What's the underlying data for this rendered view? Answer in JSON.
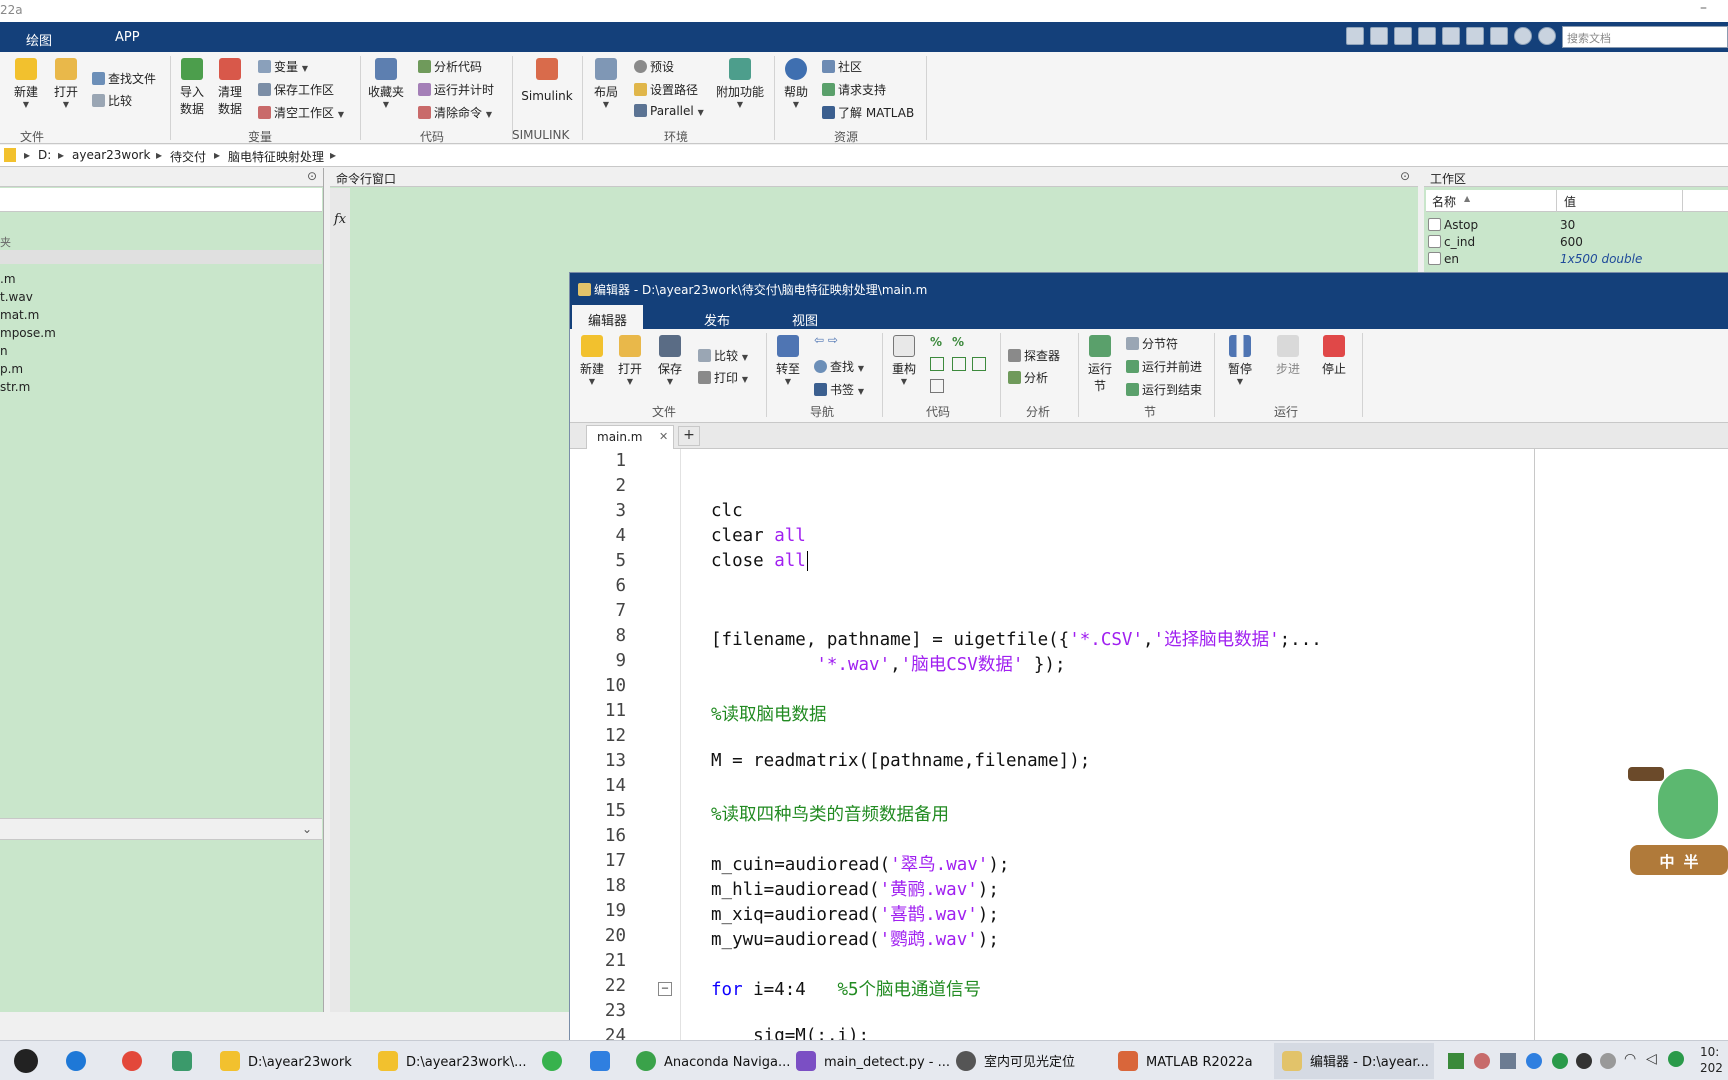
{
  "window": {
    "title": "22a",
    "min_glyph": "–"
  },
  "menubar": {
    "tabs": [
      "绘图",
      "APP"
    ],
    "search_placeholder": "搜索文档"
  },
  "ribbon": {
    "new": "新建",
    "open": "打开",
    "find_files": "查找文件",
    "compare": "比较",
    "group_file": "文件",
    "import_data_1": "导入",
    "import_data_2": "数据",
    "clean_data_1": "清理",
    "clean_data_2": "数据",
    "variable": "变量",
    "save_ws": "保存工作区",
    "clear_ws": "清空工作区",
    "group_variable": "变量",
    "favorites": "收藏夹",
    "analyze_code": "分析代码",
    "run_time": "运行并计时",
    "clear_cmds": "清除命令",
    "group_code": "代码",
    "simulink": "Simulink",
    "group_simulink": "SIMULINK",
    "layout": "布局",
    "preferences": "预设",
    "set_path": "设置路径",
    "parallel": "Parallel",
    "addons": "附加功能",
    "group_env": "环境",
    "help": "帮助",
    "community": "社区",
    "request_support": "请求支持",
    "learn_matlab": "了解 MATLAB",
    "group_resources": "资源"
  },
  "address": {
    "crumbs": [
      "D:",
      "ayear23work",
      "待交付",
      "脑电特征映射处理"
    ]
  },
  "leftpanel": {
    "section_label": "夹",
    "files": [
      ".m",
      "t.wav",
      "mat.m",
      "mpose.m",
      "n",
      "p.m",
      "str.m"
    ]
  },
  "cmdpanel": {
    "title": "命令行窗口",
    "fx": "fx"
  },
  "workspace": {
    "title": "工作区",
    "col_name": "名称",
    "col_value": "值",
    "vars": [
      {
        "name": "Astop",
        "value": "30"
      },
      {
        "name": "c_ind",
        "value": "600"
      },
      {
        "name": "en",
        "value": "1x500 double"
      }
    ]
  },
  "editor": {
    "title": "编辑器 - D:\\ayear23work\\待交付\\脑电特征映射处理\\main.m",
    "tabs": [
      "编辑器",
      "发布",
      "视图"
    ],
    "ribbon": {
      "new": "新建",
      "open": "打开",
      "save": "保存",
      "compare": "比较",
      "print": "打印",
      "group_file": "文件",
      "goto": "转至",
      "find": "查找",
      "bookmark": "书签",
      "group_nav": "导航",
      "refactor": "重构",
      "group_code": "代码",
      "profiler": "探查器",
      "analyze": "分析",
      "group_analyze": "分析",
      "run_section_1": "运行",
      "run_section_2": "节",
      "section_break": "分节符",
      "run_advance": "运行并前进",
      "run_to_end": "运行到结束",
      "group_section": "节",
      "pause": "暂停",
      "step": "步进",
      "stop": "停止",
      "group_run": "运行"
    },
    "file_tab": "main.m",
    "file_close": "✕",
    "add_tab": "+",
    "line_numbers": [
      "1",
      "2",
      "3",
      "4",
      "5",
      "6",
      "7",
      "8",
      "9",
      "10",
      "11",
      "12",
      "13",
      "14",
      "15",
      "16",
      "17",
      "18",
      "19",
      "20",
      "21",
      "22",
      "23",
      "24"
    ],
    "code": {
      "l3": "clc",
      "l4a": "clear ",
      "l4b": "all",
      "l5a": "close ",
      "l5b": "all",
      "l8a": "[filename, pathname] = uigetfile({",
      "l8b": "'*.CSV'",
      ",": ",",
      "l8c": "'选择脑电数据'",
      "l8d": ";...",
      "l9a": "          ",
      "l9b": "'*.wav'",
      "l9c": ",",
      "l9d": "'脑电CSV数据'",
      "l9e": " });",
      "l11": "%读取脑电数据",
      "l13": "M = readmatrix([pathname,filename]);",
      "l15": "%读取四种鸟类的音频数据备用",
      "l17a": "m_cuin=audioread(",
      "l17b": "'翠鸟.wav'",
      "l17c": ");",
      "l18a": "m_hli=audioread(",
      "l18b": "'黄鹂.wav'",
      "l18c": ");",
      "l19a": "m_xiq=audioread(",
      "l19b": "'喜鹊.wav'",
      "l19c": ");",
      "l20a": "m_ywu=audioread(",
      "l20b": "'鹦鹉.wav'",
      "l20c": ");",
      "l22a": "for",
      " l22b": " i=4:4   ",
      "l22c": "%5个脑电通道信号",
      "l24": "    sig=M(:,i);",
      "fold_glyph": "−"
    },
    "mascot_text": "中 半"
  },
  "taskbar": {
    "items": [
      "D:\\ayear23work",
      "D:\\ayear23work\\...",
      "Anaconda Naviga...",
      "main_detect.py - ...",
      "室内可见光定位",
      "MATLAB R2022a",
      "编辑器 - D:\\ayear..."
    ],
    "clock_time": "10:",
    "clock_date": "202"
  },
  "colors": {
    "matlab_blue": "#14407a",
    "bg_green": "#c9e6cb",
    "keyword": "#0e00ff",
    "string": "#a020f0",
    "comment": "#228b22"
  }
}
